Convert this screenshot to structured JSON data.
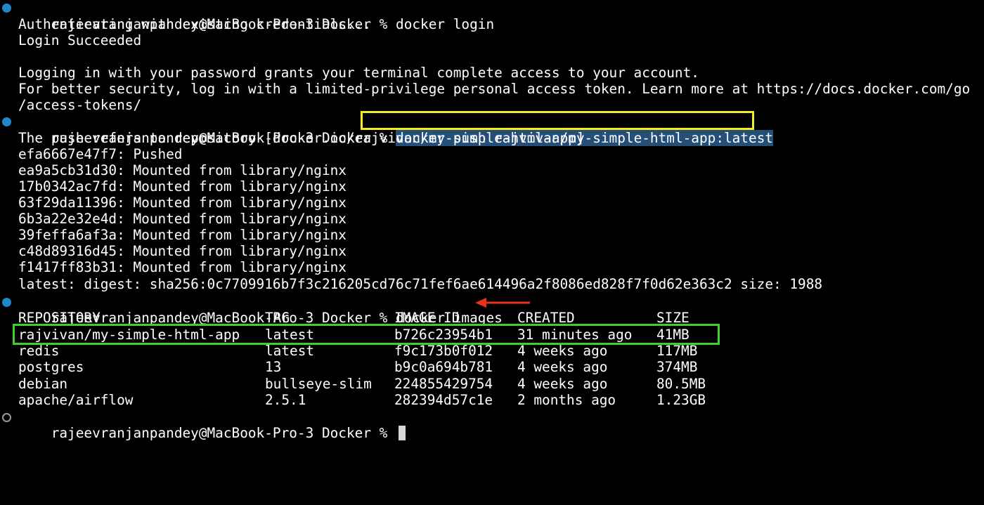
{
  "terminal": {
    "prompt": "rajeevranjanpandey@MacBook-Pro-3 Docker % ",
    "colors": {
      "background": "#000000",
      "text": "#ffffff",
      "prompt_dot_done": "#1e88c9",
      "prompt_dot_open": "#9a9a9a",
      "selection": "#264f78",
      "highlight_yellow": "#f5ec24",
      "highlight_green": "#3ad12c",
      "arrow_red": "#e8321e"
    },
    "commands": {
      "login": "docker login",
      "push": "docker push rajvivan/my-simple-html-app:latest",
      "images": "docker images"
    },
    "login_output": [
      "Authenticating with existing credentials...",
      "Login Succeeded",
      "",
      "Logging in with your password grants your terminal complete access to your account.",
      "For better security, log in with a limited-privilege personal access token. Learn more at https://docs.docker.com/go",
      "/access-tokens/"
    ],
    "push_output": [
      "The push refers to repository [docker.io/rajvivan/my-simple-html-app]",
      "efa6667e47f7: Pushed",
      "ea9a5cb31d30: Mounted from library/nginx",
      "17b0342ac7fd: Mounted from library/nginx",
      "63f29da11396: Mounted from library/nginx",
      "6b3a22e32e4d: Mounted from library/nginx",
      "39feffa6af3a: Mounted from library/nginx",
      "c48d89316d45: Mounted from library/nginx",
      "f1417ff83b31: Mounted from library/nginx",
      "latest: digest: sha256:0c7709916b7f3c216205cd76c71fef6ae614496a2f8086ed828f7f0d62e363c2 size: 1988"
    ],
    "images_table": {
      "headers": [
        "REPOSITORY",
        "TAG",
        "IMAGE ID",
        "CREATED",
        "SIZE"
      ],
      "rows": [
        [
          "rajvivan/my-simple-html-app",
          "latest",
          "b726c23954b1",
          "31 minutes ago",
          "41MB"
        ],
        [
          "redis",
          "latest",
          "f9c173b0f012",
          "4 weeks ago",
          "117MB"
        ],
        [
          "postgres",
          "13",
          "b9c0a694b781",
          "4 weeks ago",
          "374MB"
        ],
        [
          "debian",
          "bullseye-slim",
          "224855429754",
          "4 weeks ago",
          "80.5MB"
        ],
        [
          "apache/airflow",
          "2.5.1",
          "282394d57c1e",
          "2 months ago",
          "1.23GB"
        ]
      ]
    }
  }
}
